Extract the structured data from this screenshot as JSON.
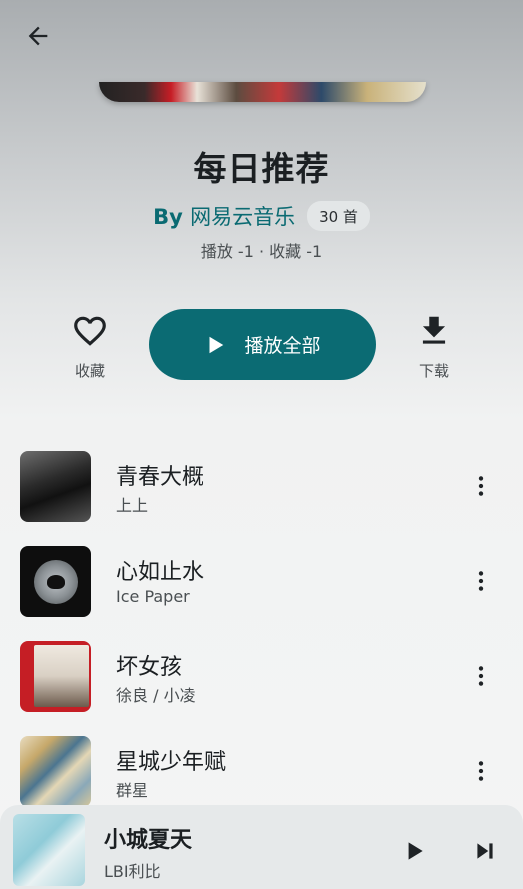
{
  "header": {
    "back_icon": "arrow-left-icon"
  },
  "playlist": {
    "title": "每日推荐",
    "creator_prefix": "By",
    "creator_name": "网易云音乐",
    "count": "30 首",
    "stats": "播放 -1 · 收藏 -1"
  },
  "actions": {
    "favorite_label": "收藏",
    "play_all_label": "播放全部",
    "download_label": "下载"
  },
  "songs": [
    {
      "title": "青春大概",
      "artist": "上上"
    },
    {
      "title": "心如止水",
      "artist": "Ice Paper"
    },
    {
      "title": "坏女孩",
      "artist": "徐良 / 小凌"
    },
    {
      "title": "星城少年赋",
      "artist": "群星"
    }
  ],
  "now_playing": {
    "title": "小城夏天",
    "artist": "LBI利比"
  },
  "colors": {
    "accent": "#0b6b73",
    "creator": "#0a6a72"
  }
}
